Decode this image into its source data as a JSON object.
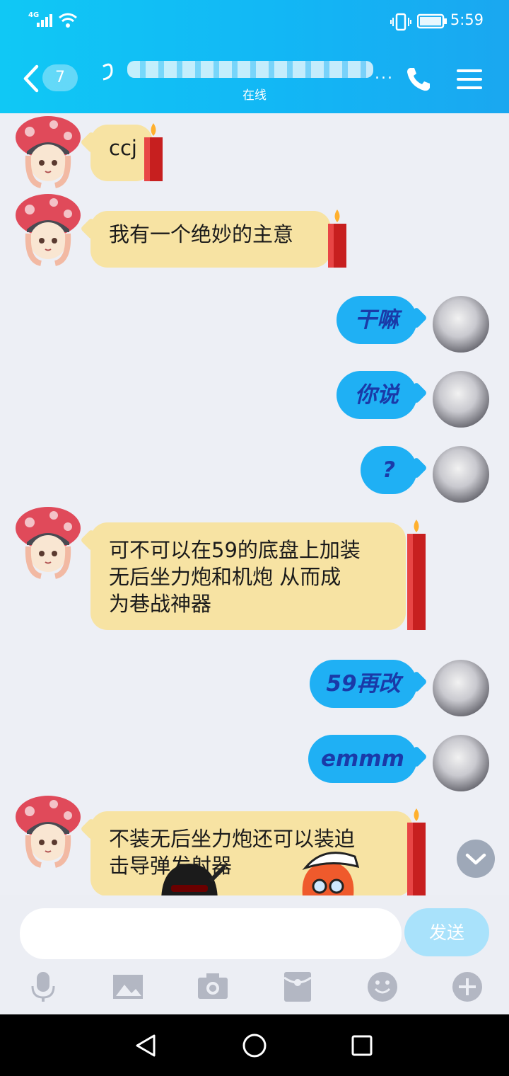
{
  "status_bar": {
    "time": "5:59",
    "network": "4G"
  },
  "header": {
    "unread_count": "7",
    "title_suffix": "...",
    "subtitle": "在线"
  },
  "messages": [
    {
      "side": "left",
      "text": "ccj"
    },
    {
      "side": "left",
      "text": "我有一个绝妙的主意"
    },
    {
      "side": "right",
      "text": "干嘛"
    },
    {
      "side": "right",
      "text": "你说"
    },
    {
      "side": "right",
      "text": "?"
    },
    {
      "side": "left",
      "lines": [
        "可不可以在59的底盘上加装",
        "无后坐力炮和机炮 从而成",
        "为巷战神器"
      ]
    },
    {
      "side": "right",
      "text": "59再改"
    },
    {
      "side": "right",
      "text": "emmm"
    },
    {
      "side": "left",
      "lines": [
        "不装无后坐力炮还可以装迫",
        "击导弹发射器"
      ]
    }
  ],
  "input": {
    "placeholder": "",
    "send_label": "发送"
  },
  "toolbar": [
    "mic-icon",
    "image-icon",
    "camera-icon",
    "red-packet-icon",
    "emoji-icon",
    "plus-icon"
  ],
  "colors": {
    "header": "#12b7f5",
    "bubble_left": "#f7e3a3",
    "bubble_right": "#1fb0f4",
    "right_text": "#1a3aa8"
  }
}
